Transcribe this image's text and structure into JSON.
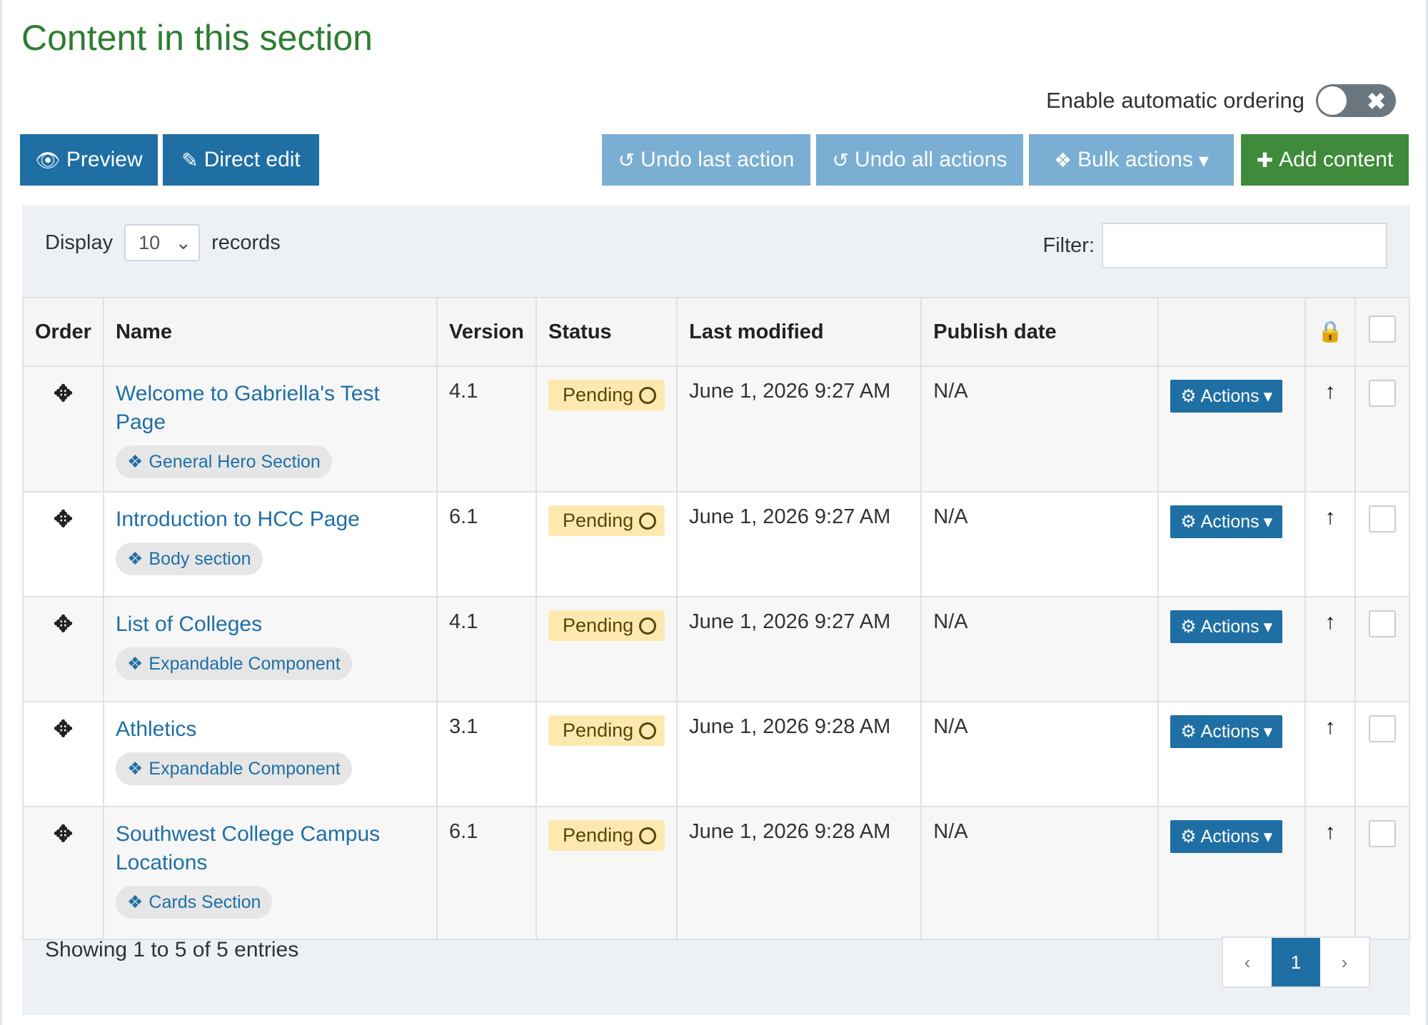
{
  "title": "Content in this section",
  "auto_ordering": {
    "label": "Enable automatic ordering",
    "toggle_icon": "x-icon"
  },
  "toolbar": {
    "preview": "Preview",
    "direct_edit": "Direct edit",
    "undo_last": "Undo last action",
    "undo_all": "Undo all actions",
    "bulk": "Bulk actions",
    "add": "Add content"
  },
  "display": {
    "prefix": "Display",
    "value": "10",
    "suffix": "records"
  },
  "filter": {
    "label": "Filter:",
    "value": ""
  },
  "columns": {
    "order": "Order",
    "name": "Name",
    "version": "Version",
    "status": "Status",
    "last_modified": "Last modified",
    "publish_date": "Publish date"
  },
  "rows": [
    {
      "name": "Welcome to Gabriella's Test Page",
      "type": "General Hero Section",
      "version": "4.1",
      "status": "Pending",
      "last_modified": "June 1, 2026 9:27 AM",
      "publish_date": "N/A",
      "actions": "Actions"
    },
    {
      "name": "Introduction to HCC Page",
      "type": "Body section",
      "version": "6.1",
      "status": "Pending",
      "last_modified": "June 1, 2026 9:27 AM",
      "publish_date": "N/A",
      "actions": "Actions"
    },
    {
      "name": "List of Colleges",
      "type": "Expandable Component",
      "version": "4.1",
      "status": "Pending",
      "last_modified": "June 1, 2026 9:27 AM",
      "publish_date": "N/A",
      "actions": "Actions"
    },
    {
      "name": "Athletics",
      "type": "Expandable Component",
      "version": "3.1",
      "status": "Pending",
      "last_modified": "June 1, 2026 9:28 AM",
      "publish_date": "N/A",
      "actions": "Actions"
    },
    {
      "name": "Southwest College Campus Locations",
      "type": "Cards Section",
      "version": "6.1",
      "status": "Pending",
      "last_modified": "June 1, 2026 9:28 AM",
      "publish_date": "N/A",
      "actions": "Actions"
    }
  ],
  "footer": {
    "info": "Showing 1 to 5 of 5 entries",
    "page": "1",
    "prev": "‹",
    "next": "›"
  },
  "colors": {
    "primary": "#1f6fa5",
    "success": "#3f8a3b",
    "title": "#2e7d32",
    "pending_bg": "#fde9b0"
  }
}
